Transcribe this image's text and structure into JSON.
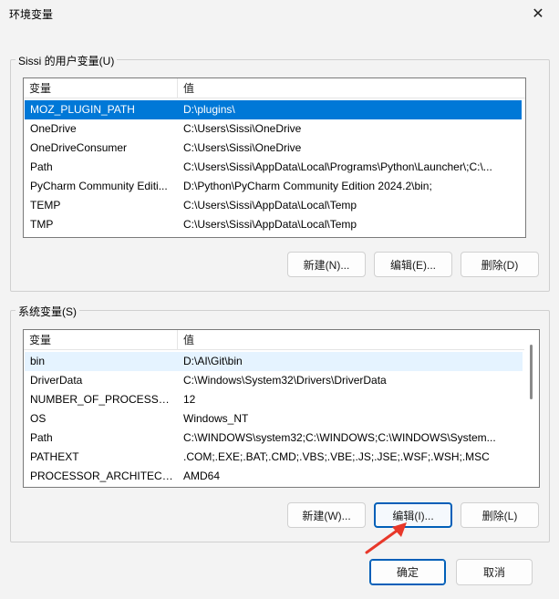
{
  "window": {
    "title": "环境变量",
    "close_glyph": "✕"
  },
  "user_vars": {
    "group_label": "Sissi 的用户变量(U)",
    "col_variable": "变量",
    "col_value": "值",
    "rows": [
      {
        "name": "MOZ_PLUGIN_PATH",
        "value": "D:\\plugins\\",
        "selected": true
      },
      {
        "name": "OneDrive",
        "value": "C:\\Users\\Sissi\\OneDrive"
      },
      {
        "name": "OneDriveConsumer",
        "value": "C:\\Users\\Sissi\\OneDrive"
      },
      {
        "name": "Path",
        "value": "C:\\Users\\Sissi\\AppData\\Local\\Programs\\Python\\Launcher\\;C:\\..."
      },
      {
        "name": "PyCharm Community Editi...",
        "value": "D:\\Python\\PyCharm Community Edition 2024.2\\bin;"
      },
      {
        "name": "TEMP",
        "value": "C:\\Users\\Sissi\\AppData\\Local\\Temp"
      },
      {
        "name": "TMP",
        "value": "C:\\Users\\Sissi\\AppData\\Local\\Temp"
      }
    ],
    "buttons": {
      "new": "新建(N)...",
      "edit": "编辑(E)...",
      "delete": "删除(D)"
    }
  },
  "system_vars": {
    "group_label": "系统变量(S)",
    "col_variable": "变量",
    "col_value": "值",
    "rows": [
      {
        "name": "bin",
        "value": "D:\\AI\\Git\\bin",
        "hover": true
      },
      {
        "name": "DriverData",
        "value": "C:\\Windows\\System32\\Drivers\\DriverData"
      },
      {
        "name": "NUMBER_OF_PROCESSORS",
        "value": "12"
      },
      {
        "name": "OS",
        "value": "Windows_NT"
      },
      {
        "name": "Path",
        "value": "C:\\WINDOWS\\system32;C:\\WINDOWS;C:\\WINDOWS\\System..."
      },
      {
        "name": "PATHEXT",
        "value": ".COM;.EXE;.BAT;.CMD;.VBS;.VBE;.JS;.JSE;.WSF;.WSH;.MSC"
      },
      {
        "name": "PROCESSOR_ARCHITECT...",
        "value": "AMD64"
      }
    ],
    "buttons": {
      "new": "新建(W)...",
      "edit": "编辑(I)...",
      "delete": "删除(L)"
    }
  },
  "footer": {
    "ok": "确定",
    "cancel": "取消"
  },
  "colors": {
    "selection": "#0078d7",
    "annotation_arrow": "#e8382a"
  }
}
